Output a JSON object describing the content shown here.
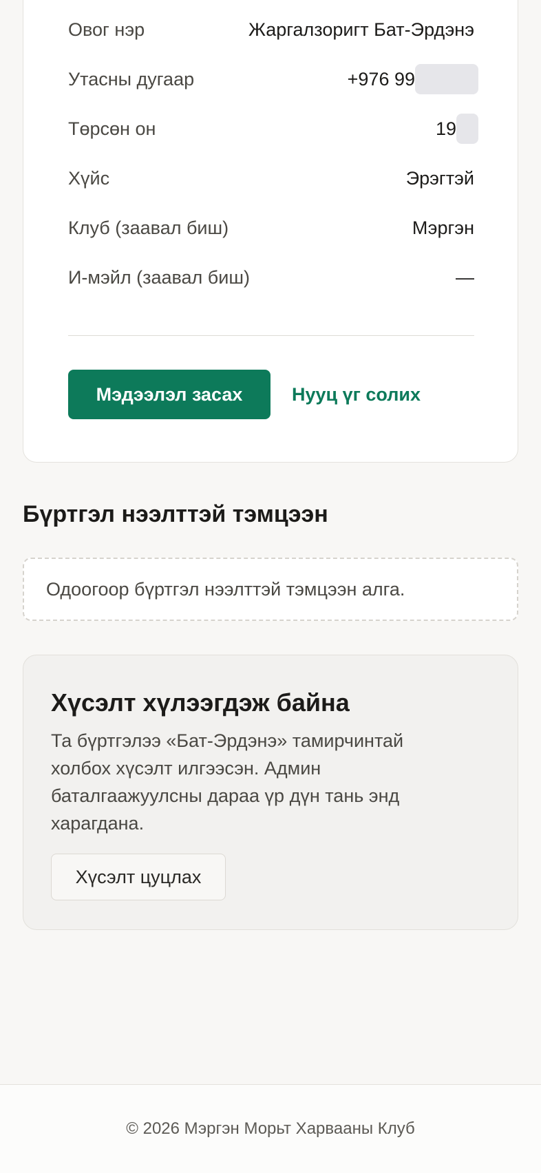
{
  "profile": {
    "rows": [
      {
        "label": "Овог нэр",
        "value": "Жаргалзоригт Бат-Эрдэнэ"
      },
      {
        "label": "Утасны дугаар",
        "value": "+976 99"
      },
      {
        "label": "Төрсөн он",
        "value": "19"
      },
      {
        "label": "Хүйс",
        "value": "Эрэгтэй"
      },
      {
        "label": "Клуб (заавал биш)",
        "value": "Мэргэн"
      },
      {
        "label": "И-мэйл (заавал биш)",
        "value": "—"
      }
    ],
    "edit_button": "Мэдээлэл засах",
    "password_link": "Нууц үг солих"
  },
  "registrations": {
    "title": "Бүртгэл нээлттэй тэмцээн",
    "empty_text": "Одоогоор бүртгэл нээлттэй тэмцээн алга."
  },
  "request": {
    "title": "Хүсэлт хүлээгдэж байна",
    "text": "Та бүртгэлээ «Бат-Эрдэнэ» тамирчинтай холбох хүсэлт илгээсэн. Админ баталгаажуулсны дараа үр дүн тань энд харагдана.",
    "cancel_button": "Хүсэлт цуцлах"
  },
  "footer": {
    "text": "© 2026 Мэргэн Морьт Харвааны Клуб"
  },
  "colors": {
    "accent": "#0d7a5a",
    "background": "#f8f7f5"
  }
}
